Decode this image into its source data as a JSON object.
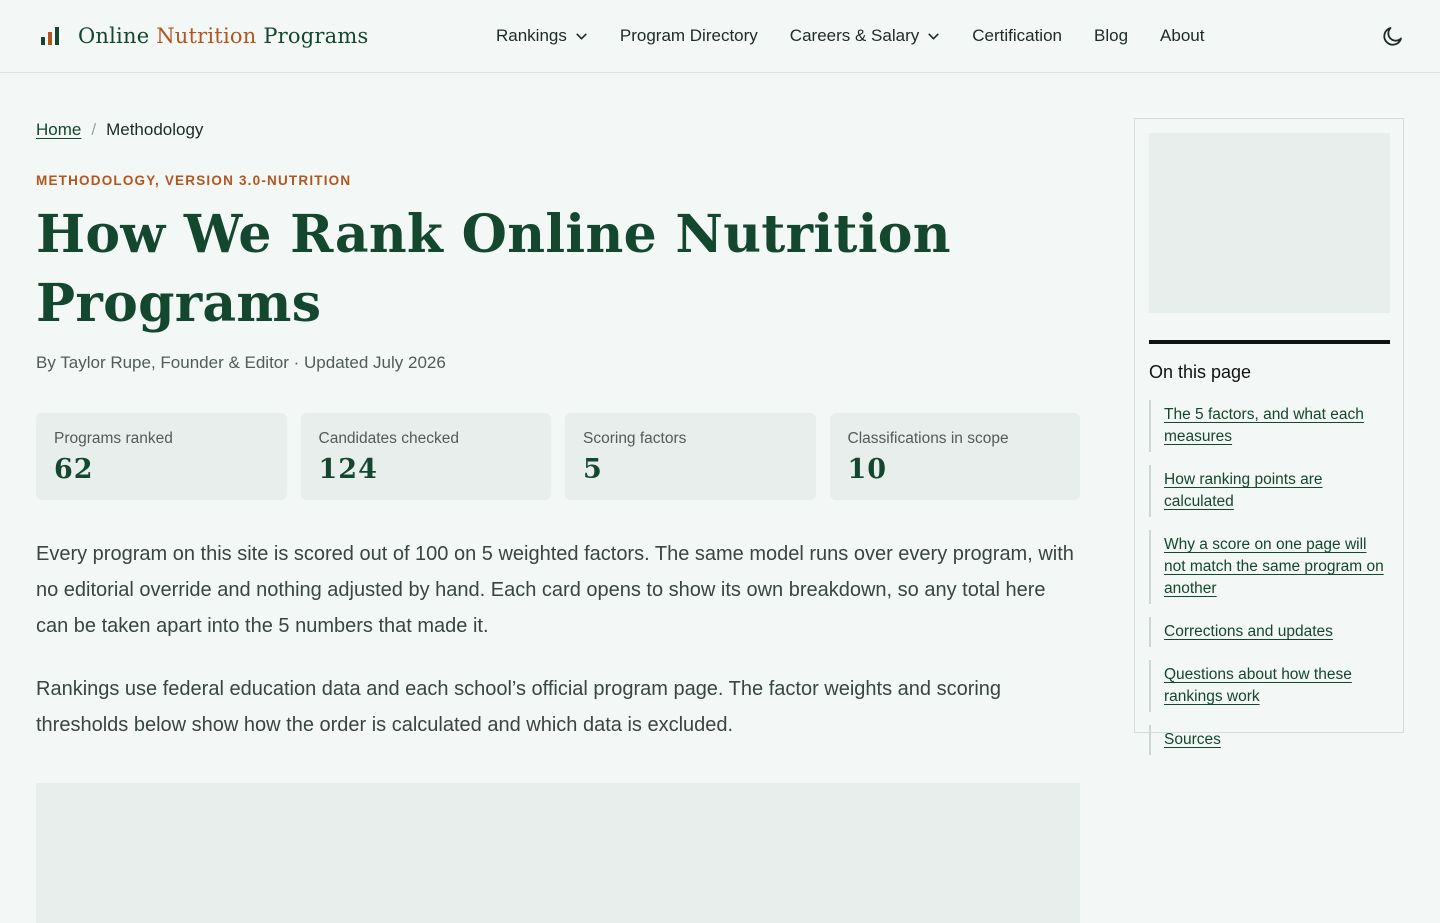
{
  "brand": {
    "word1": "Online",
    "word2": "Nutrition",
    "word3": "Programs",
    "logo_icon": "bar-chart-logo-icon",
    "colors": {
      "dark_green": "#14472f",
      "orange": "#b2561f"
    }
  },
  "nav": {
    "items": [
      {
        "label": "Rankings",
        "has_dropdown": true
      },
      {
        "label": "Program Directory",
        "has_dropdown": false
      },
      {
        "label": "Careers & Salary",
        "has_dropdown": true
      },
      {
        "label": "Certification",
        "has_dropdown": false
      },
      {
        "label": "Blog",
        "has_dropdown": false
      },
      {
        "label": "About",
        "has_dropdown": false
      }
    ],
    "theme_toggle_icon": "moon-icon"
  },
  "breadcrumb": {
    "home": "Home",
    "separator": "/",
    "current": "Methodology"
  },
  "kicker": "METHODOLOGY, VERSION 3.0-NUTRITION",
  "title": "How We Rank Online Nutrition Programs",
  "byline": "By Taylor Rupe, Founder & Editor · Updated July 2026",
  "stats": [
    {
      "label": "Programs ranked",
      "value": "62"
    },
    {
      "label": "Candidates checked",
      "value": "124"
    },
    {
      "label": "Scoring factors",
      "value": "5"
    },
    {
      "label": "Classifications in scope",
      "value": "10"
    }
  ],
  "intro": [
    "Every program on this site is scored out of 100 on 5 weighted factors. The same model runs over every program, with no editorial override and nothing adjusted by hand. Each card opens to show its own breakdown, so any total here can be taken apart into the 5 numbers that made it.",
    "Rankings use federal education data and each school’s official program page. The factor weights and scoring thresholds below show how the order is calculated and which data is excluded."
  ],
  "toc": {
    "title": "On this page",
    "items": [
      "The 5 factors, and what each measures",
      "How ranking points are calculated",
      "Why a score on one page will not match the same program on another",
      "Corrections and updates",
      "Questions about how these rankings work",
      "Sources"
    ]
  }
}
